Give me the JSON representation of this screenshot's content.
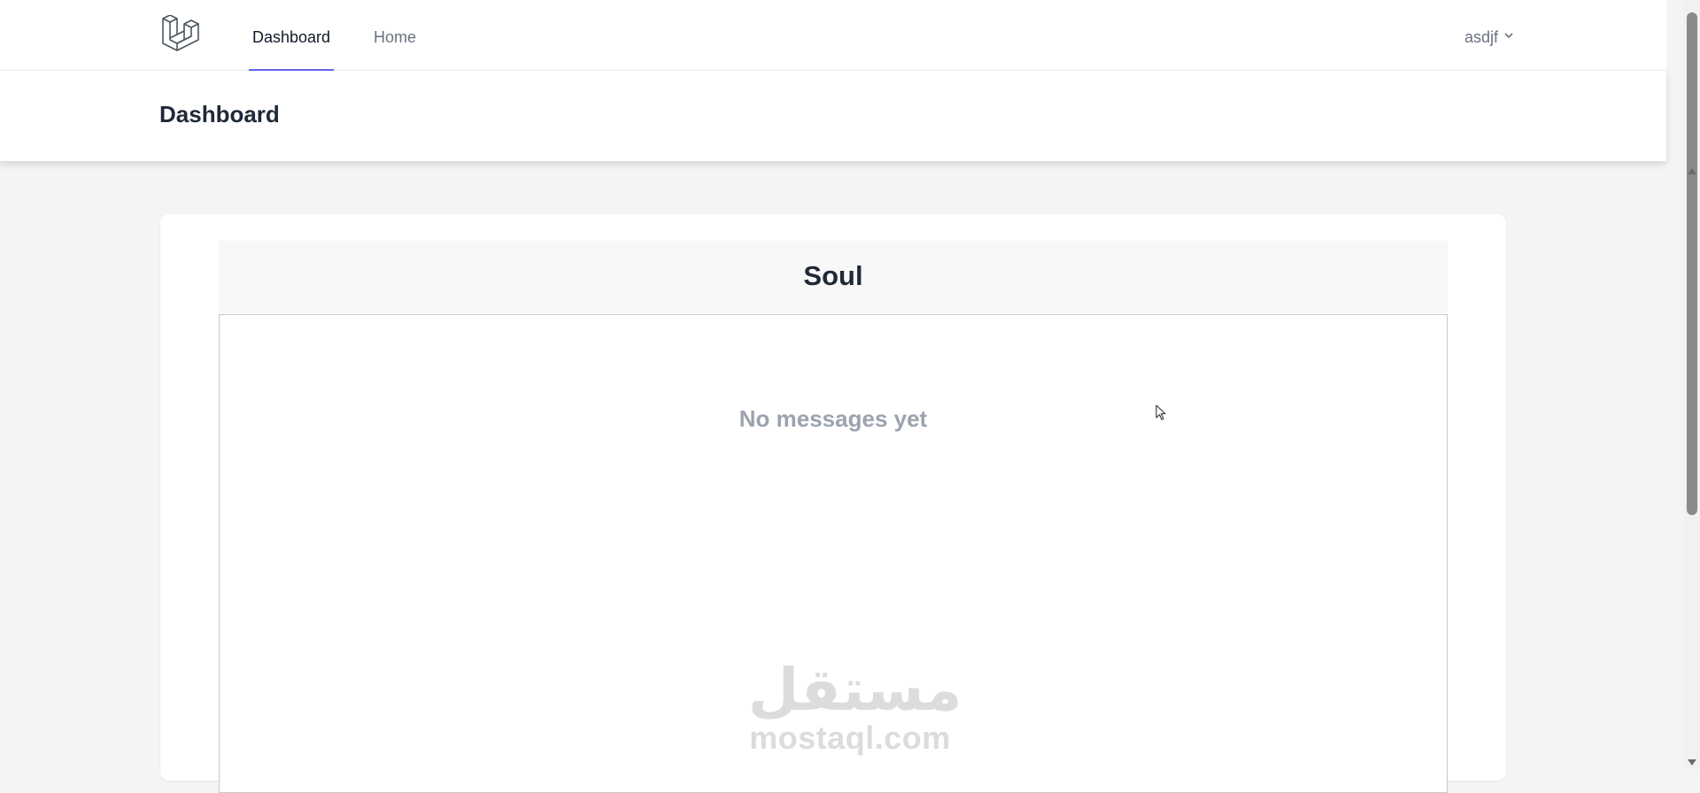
{
  "nav": {
    "logo_icon": "laravel-logo-icon",
    "links": [
      {
        "label": "Dashboard",
        "active": true
      },
      {
        "label": "Home",
        "active": false
      }
    ],
    "user": {
      "name": "asdjf",
      "icon": "chevron-down-icon"
    }
  },
  "header": {
    "title": "Dashboard"
  },
  "chat": {
    "title": "Soul",
    "empty_message": "No messages yet"
  },
  "watermark": {
    "arabic": "مستقل",
    "latin": "mostaql.com"
  },
  "colors": {
    "accent": "#6366f1",
    "background": "#f3f4f6",
    "muted_text": "#9ca3af"
  }
}
